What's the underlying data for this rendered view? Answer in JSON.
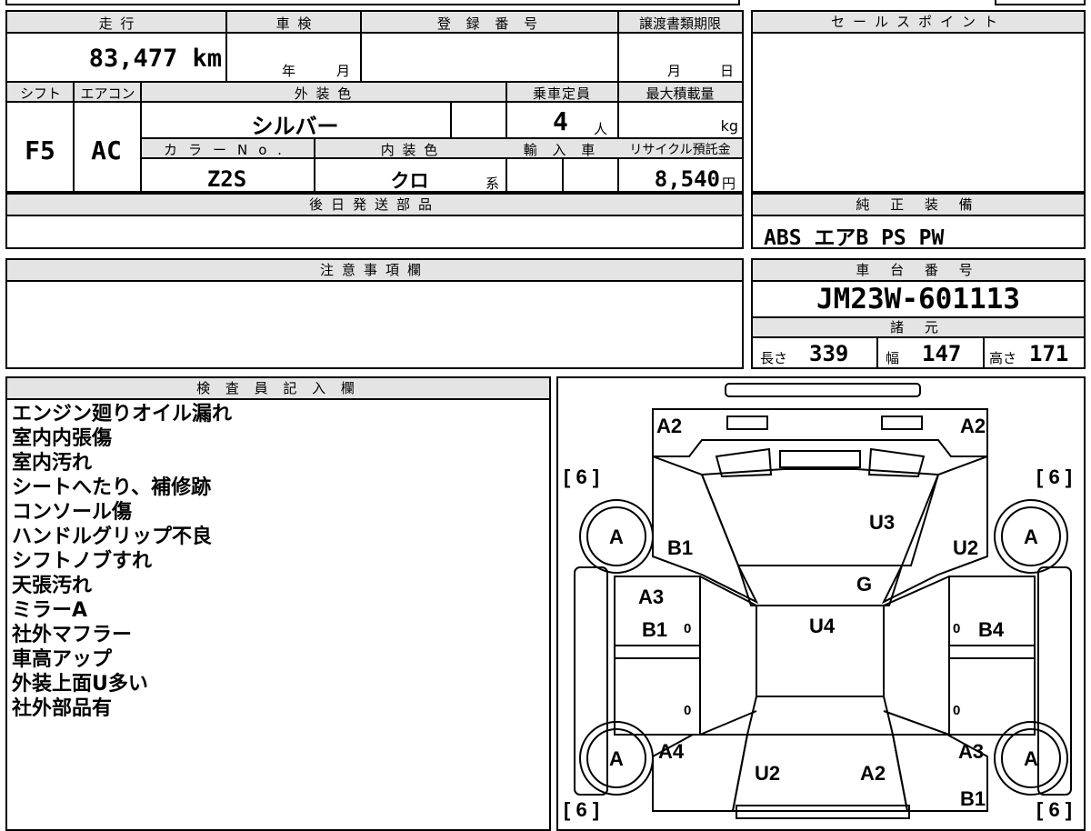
{
  "vehicle": {
    "mileage_label": "走 行",
    "mileage_value": "83,477 km",
    "inspection_label": "車 検",
    "inspection_year_unit": "年",
    "inspection_month_unit": "月",
    "registration_label": "登 録 番 号",
    "transfer_deadline_label": "譲渡書類期限",
    "transfer_month_unit": "月",
    "transfer_day_unit": "日",
    "shift_label": "シフト",
    "shift_value": "F5",
    "ac_label": "エアコン",
    "ac_value": "AC",
    "exterior_color_label": "外 装 色",
    "exterior_color_value": "シルバー",
    "capacity_label": "乗車定員",
    "capacity_value": "4",
    "capacity_unit": "人",
    "max_load_label": "最大積載量",
    "max_load_unit": "kg",
    "color_no_label": "カラーNo.",
    "color_no_value": "Z2S",
    "interior_color_label": "内 装 色",
    "interior_color_value": "クロ",
    "interior_color_suffix": "系",
    "import_label": "輸 入 車",
    "recycle_label": "リサイクル預託金",
    "recycle_value": "8,540",
    "recycle_unit": "円"
  },
  "sales_point": {
    "label": "セールスポイント"
  },
  "later_parts": {
    "label": "後日発送部品"
  },
  "notes": {
    "label": "注意事項欄"
  },
  "standard_equipment": {
    "label": "純 正 装 備",
    "value": "ABS エアB PS PW"
  },
  "chassis": {
    "label": "車 台 番 号",
    "value": "JM23W-601113"
  },
  "specs": {
    "label": "諸 元",
    "length_label": "長さ",
    "length_value": "339",
    "width_label": "幅",
    "width_value": "147",
    "height_label": "高さ",
    "height_value": "171"
  },
  "inspector": {
    "label": "検 査 員 記 入 欄",
    "lines": [
      "エンジン廻りオイル漏れ",
      "室内内張傷",
      "室内汚れ",
      "シートへたり、補修跡",
      "コンソール傷",
      "ハンドルグリップ不良",
      "シフトノブすれ",
      "天張汚れ",
      "ミラーA",
      "社外マフラー",
      "車高アップ",
      "外装上面U多い",
      "社外部品有"
    ]
  },
  "diagram": {
    "tire_left_top": "[ 6 ]",
    "tire_right_top": "[ 6 ]",
    "tire_left_bottom": "[ 6 ]",
    "tire_right_bottom": "[ 6 ]",
    "wheel_fl": "A",
    "wheel_fr": "A",
    "wheel_rl": "A",
    "wheel_rr": "A",
    "bumper_front_left": "A2",
    "bumper_front_right": "A2",
    "fender_left": "B1",
    "fender_right": "U2",
    "bonnet": "U3",
    "windshield": "G",
    "roof": "U4",
    "door_left_a": "A3",
    "door_left_b": "B1",
    "door_left_mark": "0",
    "door_right_mark": "0",
    "door_right_b": "B4",
    "rear_door_left_mark": "0",
    "rear_door_right_mark": "0",
    "quarter_left": "A4",
    "quarter_right": "A3",
    "rear_right_b": "B1",
    "back_door_left": "U2",
    "back_door_right": "A2"
  }
}
